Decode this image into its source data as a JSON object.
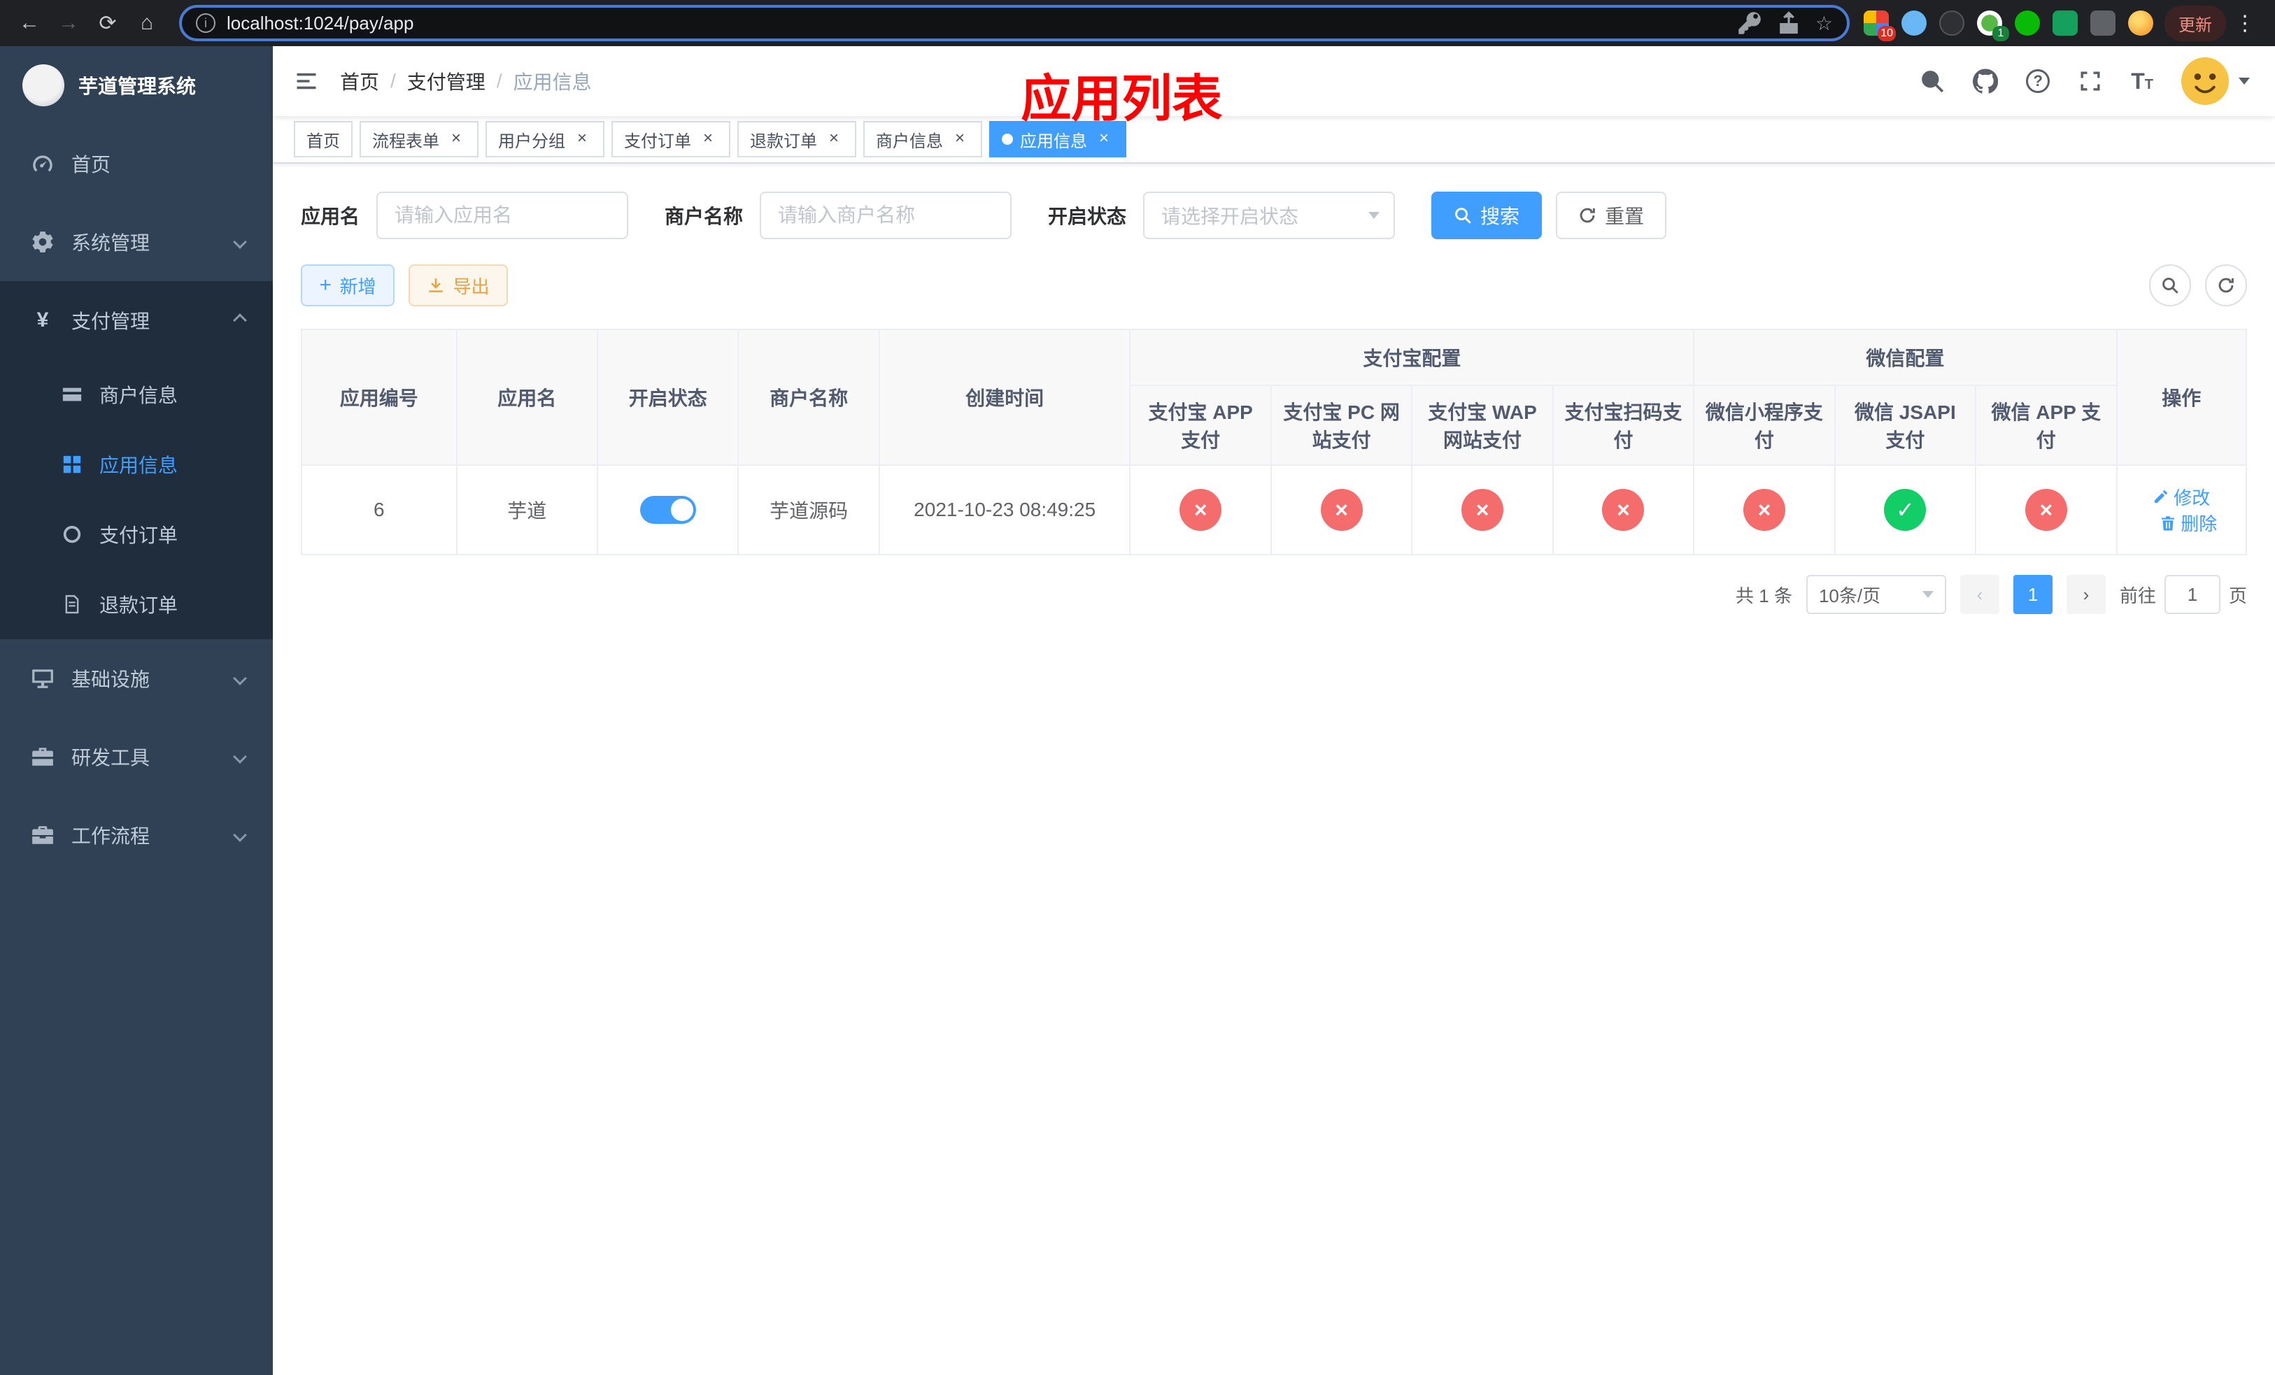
{
  "browser": {
    "url": "localhost:1024/pay/app",
    "update_label": "更新",
    "ext_badge_red": "10",
    "ext_badge_green": "1"
  },
  "sidebar": {
    "title": "芋道管理系统",
    "items": [
      {
        "label": "首页"
      },
      {
        "label": "系统管理"
      },
      {
        "label": "支付管理",
        "children": [
          {
            "label": "商户信息"
          },
          {
            "label": "应用信息",
            "active": true
          },
          {
            "label": "支付订单"
          },
          {
            "label": "退款订单"
          }
        ]
      },
      {
        "label": "基础设施"
      },
      {
        "label": "研发工具"
      },
      {
        "label": "工作流程"
      }
    ]
  },
  "header": {
    "breadcrumb": [
      "首页",
      "支付管理",
      "应用信息"
    ],
    "overlay_title": "应用列表"
  },
  "tabs": [
    {
      "label": "首页",
      "closable": false
    },
    {
      "label": "流程表单",
      "closable": true
    },
    {
      "label": "用户分组",
      "closable": true
    },
    {
      "label": "支付订单",
      "closable": true
    },
    {
      "label": "退款订单",
      "closable": true
    },
    {
      "label": "商户信息",
      "closable": true
    },
    {
      "label": "应用信息",
      "closable": true,
      "active": true
    }
  ],
  "filters": {
    "app_name_label": "应用名",
    "app_name_placeholder": "请输入应用名",
    "merchant_label": "商户名称",
    "merchant_placeholder": "请输入商户名称",
    "status_label": "开启状态",
    "status_placeholder": "请选择开启状态",
    "search_label": "搜索",
    "reset_label": "重置"
  },
  "toolbar": {
    "add_label": "新增",
    "export_label": "导出"
  },
  "table": {
    "groups": {
      "alipay": "支付宝配置",
      "wechat": "微信配置"
    },
    "columns": {
      "app_id": "应用编号",
      "app_name": "应用名",
      "status": "开启状态",
      "merchant": "商户名称",
      "created": "创建时间",
      "alipay_app": "支付宝 APP 支付",
      "alipay_pc": "支付宝 PC 网站支付",
      "alipay_wap": "支付宝 WAP 网站支付",
      "alipay_qr": "支付宝扫码支付",
      "wx_mini": "微信小程序支付",
      "wx_jsapi": "微信 JSAPI 支付",
      "wx_app": "微信 APP 支付",
      "actions": "操作"
    },
    "rows": [
      {
        "app_id": "6",
        "app_name": "芋道",
        "enabled": true,
        "merchant": "芋道源码",
        "created": "2021-10-23 08:49:25",
        "configs": [
          false,
          false,
          false,
          false,
          false,
          true,
          false
        ],
        "edit_label": "修改",
        "delete_label": "删除"
      }
    ]
  },
  "pagination": {
    "total_text": "共 1 条",
    "page_size": "10条/页",
    "current_page": "1",
    "goto_prefix": "前往",
    "goto_value": "1",
    "goto_suffix": "页"
  }
}
